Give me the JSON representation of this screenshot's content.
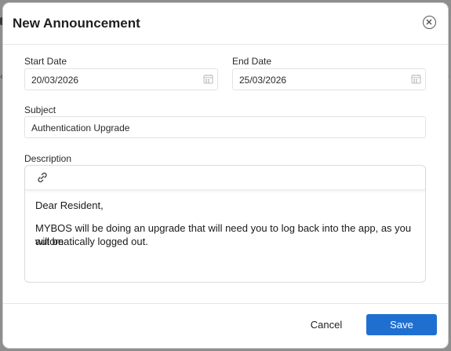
{
  "modal": {
    "title": "New Announcement",
    "close_icon": "close-circle-icon"
  },
  "form": {
    "start_date": {
      "label": "Start Date",
      "value": "20/03/2026",
      "icon": "calendar-icon"
    },
    "end_date": {
      "label": "End Date",
      "value": "25/03/2026",
      "icon": "calendar-icon"
    },
    "subject": {
      "label": "Subject",
      "value": "Authentication Upgrade"
    },
    "description": {
      "label": "Description",
      "toolbar_icon": "link-icon",
      "greeting": "Dear Resident,",
      "line1": "MYBOS will be doing an upgrade that will need you to log back into the app, as you will be",
      "line2": "automatically logged out."
    }
  },
  "footer": {
    "cancel_label": "Cancel",
    "save_label": "Save"
  },
  "colors": {
    "accent": "#1f6fd1",
    "overlay": "#8e8e8e"
  }
}
